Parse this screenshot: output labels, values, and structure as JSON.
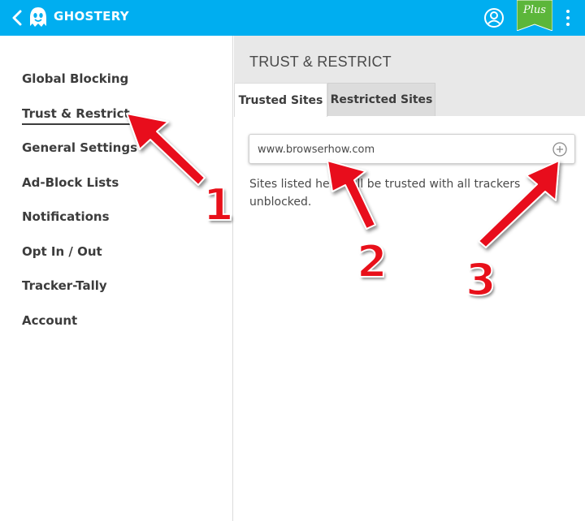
{
  "header": {
    "brand": "GHOSTERY",
    "plus_label": "Plus",
    "colors": {
      "bar": "#00aef0",
      "plus_badge": "#5cb63a"
    },
    "icons": [
      "back-chevron-icon",
      "ghost-logo-icon",
      "account-icon",
      "plus-ribbon-icon",
      "more-vert-icon"
    ]
  },
  "sidebar": {
    "items": [
      {
        "label": "Global Blocking"
      },
      {
        "label": "Trust & Restrict",
        "active": true
      },
      {
        "label": "General Settings"
      },
      {
        "label": "Ad-Block Lists"
      },
      {
        "label": "Notifications"
      },
      {
        "label": "Opt In / Out"
      },
      {
        "label": "Tracker-Tally"
      },
      {
        "label": "Account"
      }
    ]
  },
  "main": {
    "title": "TRUST & RESTRICT",
    "tabs": [
      {
        "label": "Trusted Sites",
        "active": true
      },
      {
        "label": "Restricted Sites",
        "active": false
      }
    ],
    "url_input": {
      "value": "www.browserhow.com",
      "placeholder": ""
    },
    "help_text": "Sites listed here will be trusted with all trackers unblocked."
  },
  "annotations": {
    "color": "#e8101a",
    "labels": [
      "1",
      "2",
      "3"
    ]
  }
}
